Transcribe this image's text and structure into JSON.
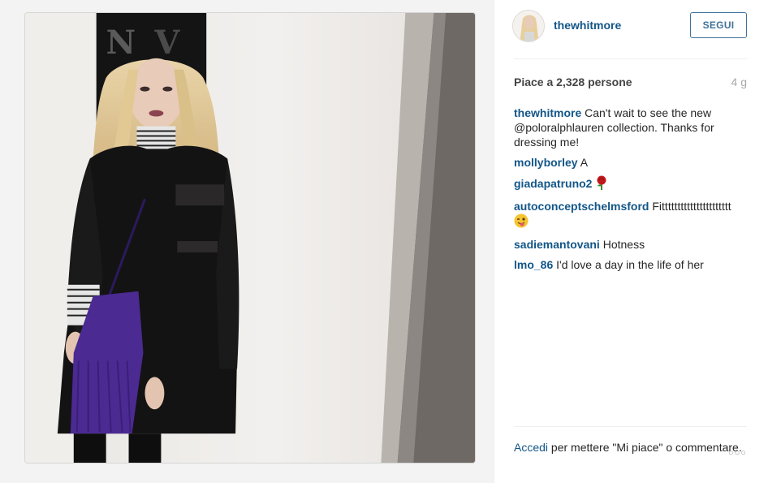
{
  "post": {
    "username": "thewhitmore",
    "follow_label": "SEGUI",
    "likes_text": "Piace a 2,328 persone",
    "age_text": "4 g",
    "caption": {
      "author": "thewhitmore",
      "text": "Can't wait to see the new @poloralphlauren collection. Thanks for dressing me!"
    },
    "comments": [
      {
        "author": "mollyborley",
        "text": "A"
      },
      {
        "author": "giadapatruno2",
        "text": "",
        "emoji": "rose-emoji"
      },
      {
        "author": "autoconceptschelmsford",
        "text": "Fitttttttttttttttttttttt",
        "emoji": "winking-face-tongue-emoji"
      },
      {
        "author": "sadiemantovani",
        "text": "Hotness"
      },
      {
        "author": "lmo_86",
        "text": "I'd love a day in the life of her"
      }
    ],
    "footer": {
      "login_link": "Accedi",
      "login_rest": "per mettere \"Mi piace\" o commentare."
    },
    "more_label": "○○○"
  },
  "colors": {
    "link": "#125688",
    "follow_border": "#3f729b",
    "muted": "#a5a7aa"
  }
}
